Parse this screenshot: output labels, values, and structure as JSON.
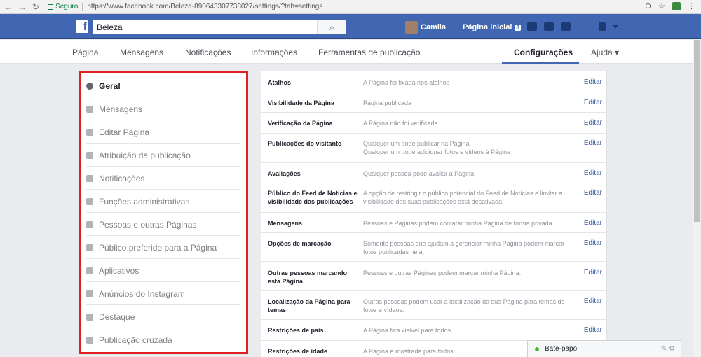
{
  "browser": {
    "secure_label": "Seguro",
    "url": "https://www.facebook.com/Beleza-890643307738027/settings/?tab=settings"
  },
  "topbar": {
    "search_value": "Beleza",
    "user_name": "Camila",
    "home_label": "Página inicial",
    "home_badge": "8"
  },
  "tabs": {
    "items": [
      "Página",
      "Mensagens",
      "Notificações",
      "Informações",
      "Ferramentas de publicação",
      "Configurações",
      "Ajuda ▾"
    ],
    "active": "Configurações"
  },
  "sidebar": {
    "items": [
      {
        "label": "Geral",
        "icon": "gear-icon"
      },
      {
        "label": "Mensagens",
        "icon": "messages-icon"
      },
      {
        "label": "Editar Página",
        "icon": "gear-icon"
      },
      {
        "label": "Atribuição da publicação",
        "icon": "flag-icon"
      },
      {
        "label": "Notificações",
        "icon": "globe-icon"
      },
      {
        "label": "Funções administrativas",
        "icon": "person-icon"
      },
      {
        "label": "Pessoas e outras Páginas",
        "icon": "person-plus-icon"
      },
      {
        "label": "Público preferido para a Página",
        "icon": "person-plus-icon"
      },
      {
        "label": "Aplicativos",
        "icon": "cube-icon"
      },
      {
        "label": "Anúncios do Instagram",
        "icon": "instagram-icon"
      },
      {
        "label": "Destaque",
        "icon": "star-icon"
      },
      {
        "label": "Publicação cruzada",
        "icon": "video-icon"
      }
    ]
  },
  "settings": {
    "edit_label": "Editar",
    "rows": [
      {
        "label": "Atalhos",
        "value": "A Página foi fixada nos atalhos"
      },
      {
        "label": "Visibilidade da Página",
        "value": "Página publicada"
      },
      {
        "label": "Verificação da Página",
        "value": "A Página não foi verificada"
      },
      {
        "label": "Publicações do visitante",
        "value": "Qualquer um pode publicar na Página",
        "value2": "Qualquer um pode adicionar fotos e vídeos à Página"
      },
      {
        "label": "Avaliações",
        "value": "Qualquer pessoa pode avaliar a Página"
      },
      {
        "label": "Público do Feed de Notícias e visibilidade das publicações",
        "value": "A opção de restringir o público potencial do Feed de Notícias e limitar a visibilidade das suas publicações está desativada"
      },
      {
        "label": "Mensagens",
        "value": "Pessoas e Páginas podem contatar minha Página de forma privada."
      },
      {
        "label": "Opções de marcação",
        "value": "Somente pessoas que ajudam a gerenciar minha Página podem marcar fotos publicadas nela."
      },
      {
        "label": "Outras pessoas marcando esta Página",
        "value": "Pessoas e outras Páginas podem marcar minha Página."
      },
      {
        "label": "Localização da Página para temas",
        "value": "Outras pessoas podem usar a localização da sua Página para temas de fotos e vídeos."
      },
      {
        "label": "Restrições de país",
        "value": "A Página fica visível para todos."
      },
      {
        "label": "Restrições de idade",
        "value": "A Página é mostrada para todos."
      }
    ]
  },
  "chat": {
    "label": "Bate-papo"
  }
}
